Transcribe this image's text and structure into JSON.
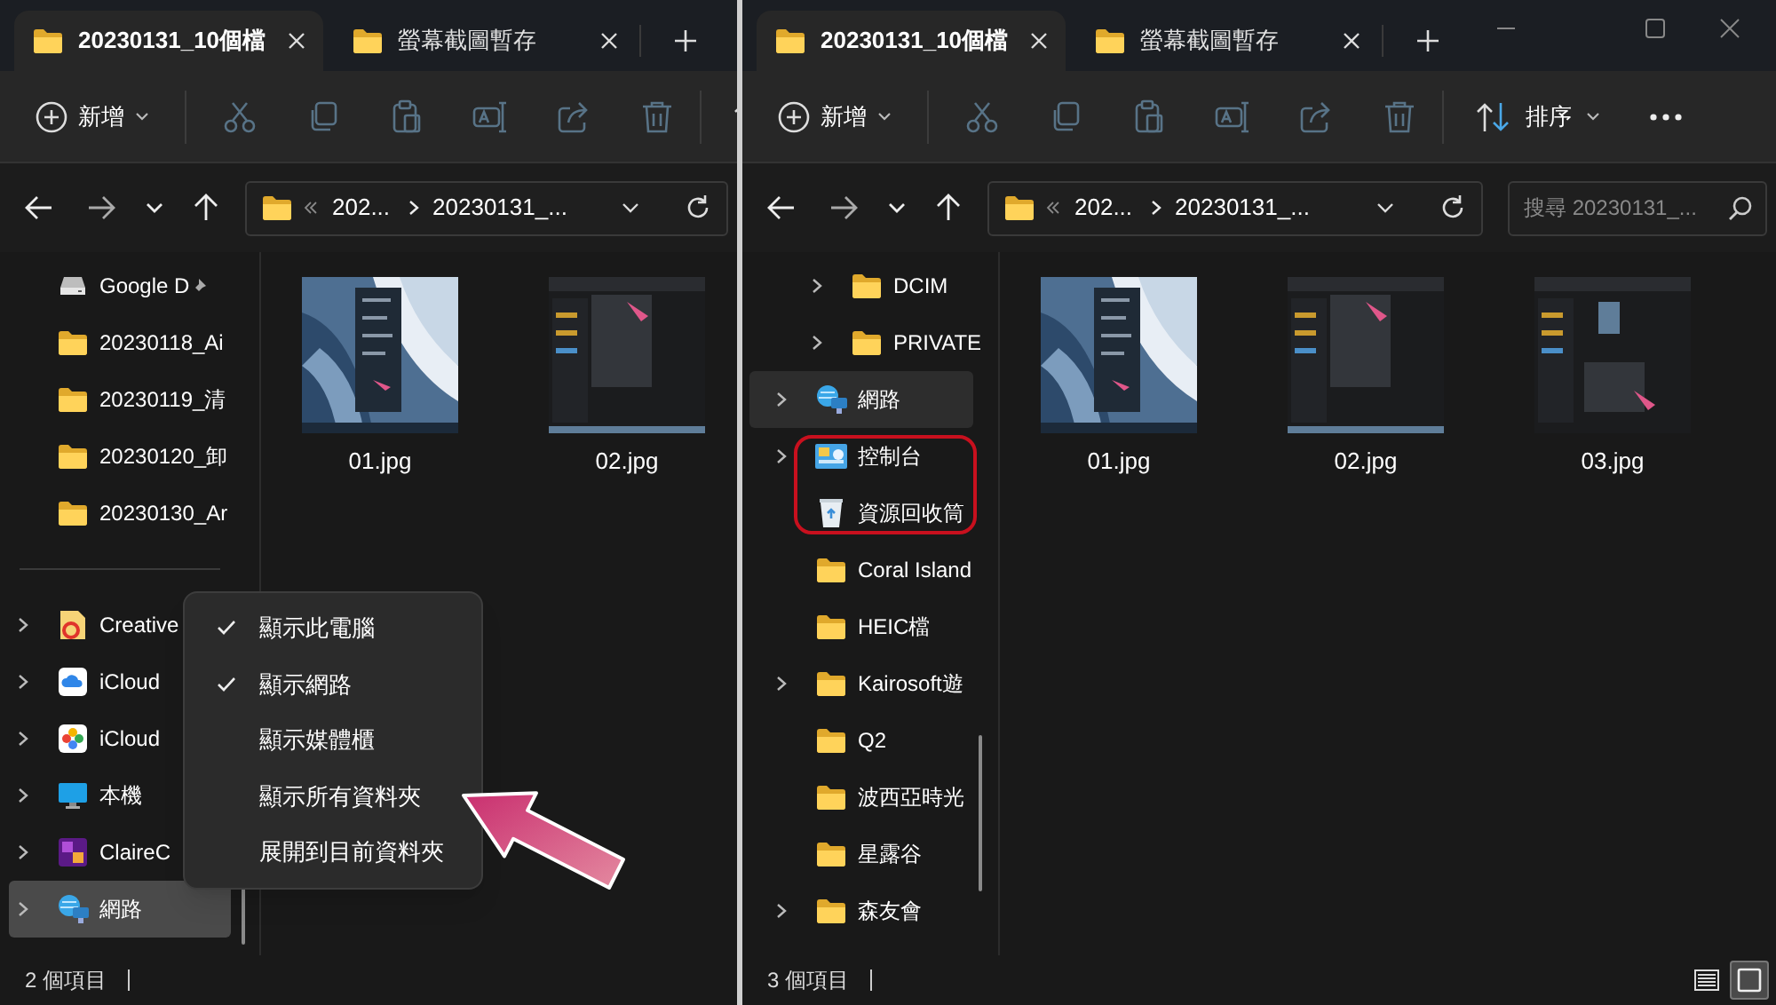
{
  "windows": [
    {
      "tabs": [
        {
          "label": "20230131_10個檔",
          "selected": true
        },
        {
          "label": "螢幕截圖暫存",
          "selected": false
        }
      ],
      "toolbar": {
        "new_label": "新增"
      },
      "address": {
        "crumbs": [
          "202...",
          "20230131_..."
        ]
      },
      "sidebar": {
        "groups": [
          [
            {
              "kind": "drive",
              "label": "Google D",
              "pinned": true,
              "expandable": false,
              "selected": false
            },
            {
              "kind": "folder",
              "label": "20230118_Ai",
              "expandable": false,
              "selected": false
            },
            {
              "kind": "folder",
              "label": "20230119_清",
              "expandable": false,
              "selected": false
            },
            {
              "kind": "folder",
              "label": "20230120_卸",
              "expandable": false,
              "selected": false
            },
            {
              "kind": "folder",
              "label": "20230130_Ar",
              "expandable": false,
              "selected": false
            }
          ],
          [
            {
              "kind": "creative-cloud",
              "label": "Creative",
              "expandable": true,
              "selected": false
            },
            {
              "kind": "icloud-drive",
              "label": "iCloud",
              "expandable": true,
              "selected": false
            },
            {
              "kind": "icloud-photos",
              "label": "iCloud",
              "expandable": true,
              "selected": false
            },
            {
              "kind": "this-pc",
              "label": "本機",
              "expandable": true,
              "selected": false
            },
            {
              "kind": "app",
              "label": "ClaireC",
              "expandable": true,
              "selected": false
            },
            {
              "kind": "network",
              "label": "網路",
              "expandable": true,
              "selected": true
            }
          ]
        ]
      },
      "files": [
        {
          "name": "01.jpg",
          "kind": "picture"
        },
        {
          "name": "02.jpg",
          "kind": "picture"
        }
      ],
      "context_menu": {
        "items": [
          {
            "label": "顯示此電腦",
            "checked": true
          },
          {
            "label": "顯示網路",
            "checked": true
          },
          {
            "label": "顯示媒體櫃",
            "checked": false
          },
          {
            "label": "顯示所有資料夾",
            "checked": false
          },
          {
            "label": "展開到目前資料夾",
            "checked": false
          }
        ]
      },
      "pointer_arrow": true,
      "status": "2 個項目"
    },
    {
      "tabs": [
        {
          "label": "20230131_10個檔",
          "selected": true
        },
        {
          "label": "螢幕截圖暫存",
          "selected": false
        }
      ],
      "window_controls": true,
      "toolbar": {
        "new_label": "新增",
        "sort_label": "排序",
        "more": true
      },
      "address": {
        "crumbs": [
          "202...",
          "20230131_..."
        ]
      },
      "search": {
        "placeholder": "搜尋 20230131_..."
      },
      "sidebar": {
        "groups": [
          [
            {
              "children": [
                {
                  "kind": "folder",
                  "label": "DCIM",
                  "expandable": true,
                  "selected": false,
                  "highlighted": false
                },
                {
                  "kind": "folder",
                  "label": "PRIVATE",
                  "expandable": true,
                  "selected": false,
                  "highlighted": false
                }
              ]
            },
            {
              "kind": "network",
              "label": "網路",
              "expandable": true,
              "selected": true,
              "highlighted": false
            },
            {
              "kind": "control-panel",
              "label": "控制台",
              "expandable": true,
              "selected": false,
              "highlighted": true
            },
            {
              "kind": "recycle-bin",
              "label": "資源回收筒",
              "expandable": false,
              "selected": false,
              "highlighted": true
            },
            {
              "kind": "folder",
              "label": "Coral Island",
              "expandable": false,
              "selected": false,
              "highlighted": false
            },
            {
              "kind": "folder",
              "label": "HEIC檔",
              "expandable": false,
              "selected": false,
              "highlighted": false
            },
            {
              "kind": "folder",
              "label": "Kairosoft遊",
              "expandable": true,
              "selected": false,
              "highlighted": false
            },
            {
              "kind": "folder",
              "label": "Q2",
              "expandable": false,
              "selected": false,
              "highlighted": false
            },
            {
              "kind": "folder",
              "label": "波西亞時光",
              "expandable": false,
              "selected": false,
              "highlighted": false
            },
            {
              "kind": "folder",
              "label": "星露谷",
              "expandable": false,
              "selected": false,
              "highlighted": false
            },
            {
              "kind": "folder",
              "label": "森友會",
              "expandable": true,
              "selected": false,
              "highlighted": false
            }
          ]
        ]
      },
      "files": [
        {
          "name": "01.jpg",
          "kind": "picture"
        },
        {
          "name": "02.jpg",
          "kind": "picture"
        },
        {
          "name": "03.jpg",
          "kind": "picture"
        }
      ],
      "status": "3 個項目",
      "view_buttons": [
        {
          "kind": "details",
          "selected": false
        },
        {
          "kind": "tiles",
          "selected": true
        }
      ]
    }
  ]
}
